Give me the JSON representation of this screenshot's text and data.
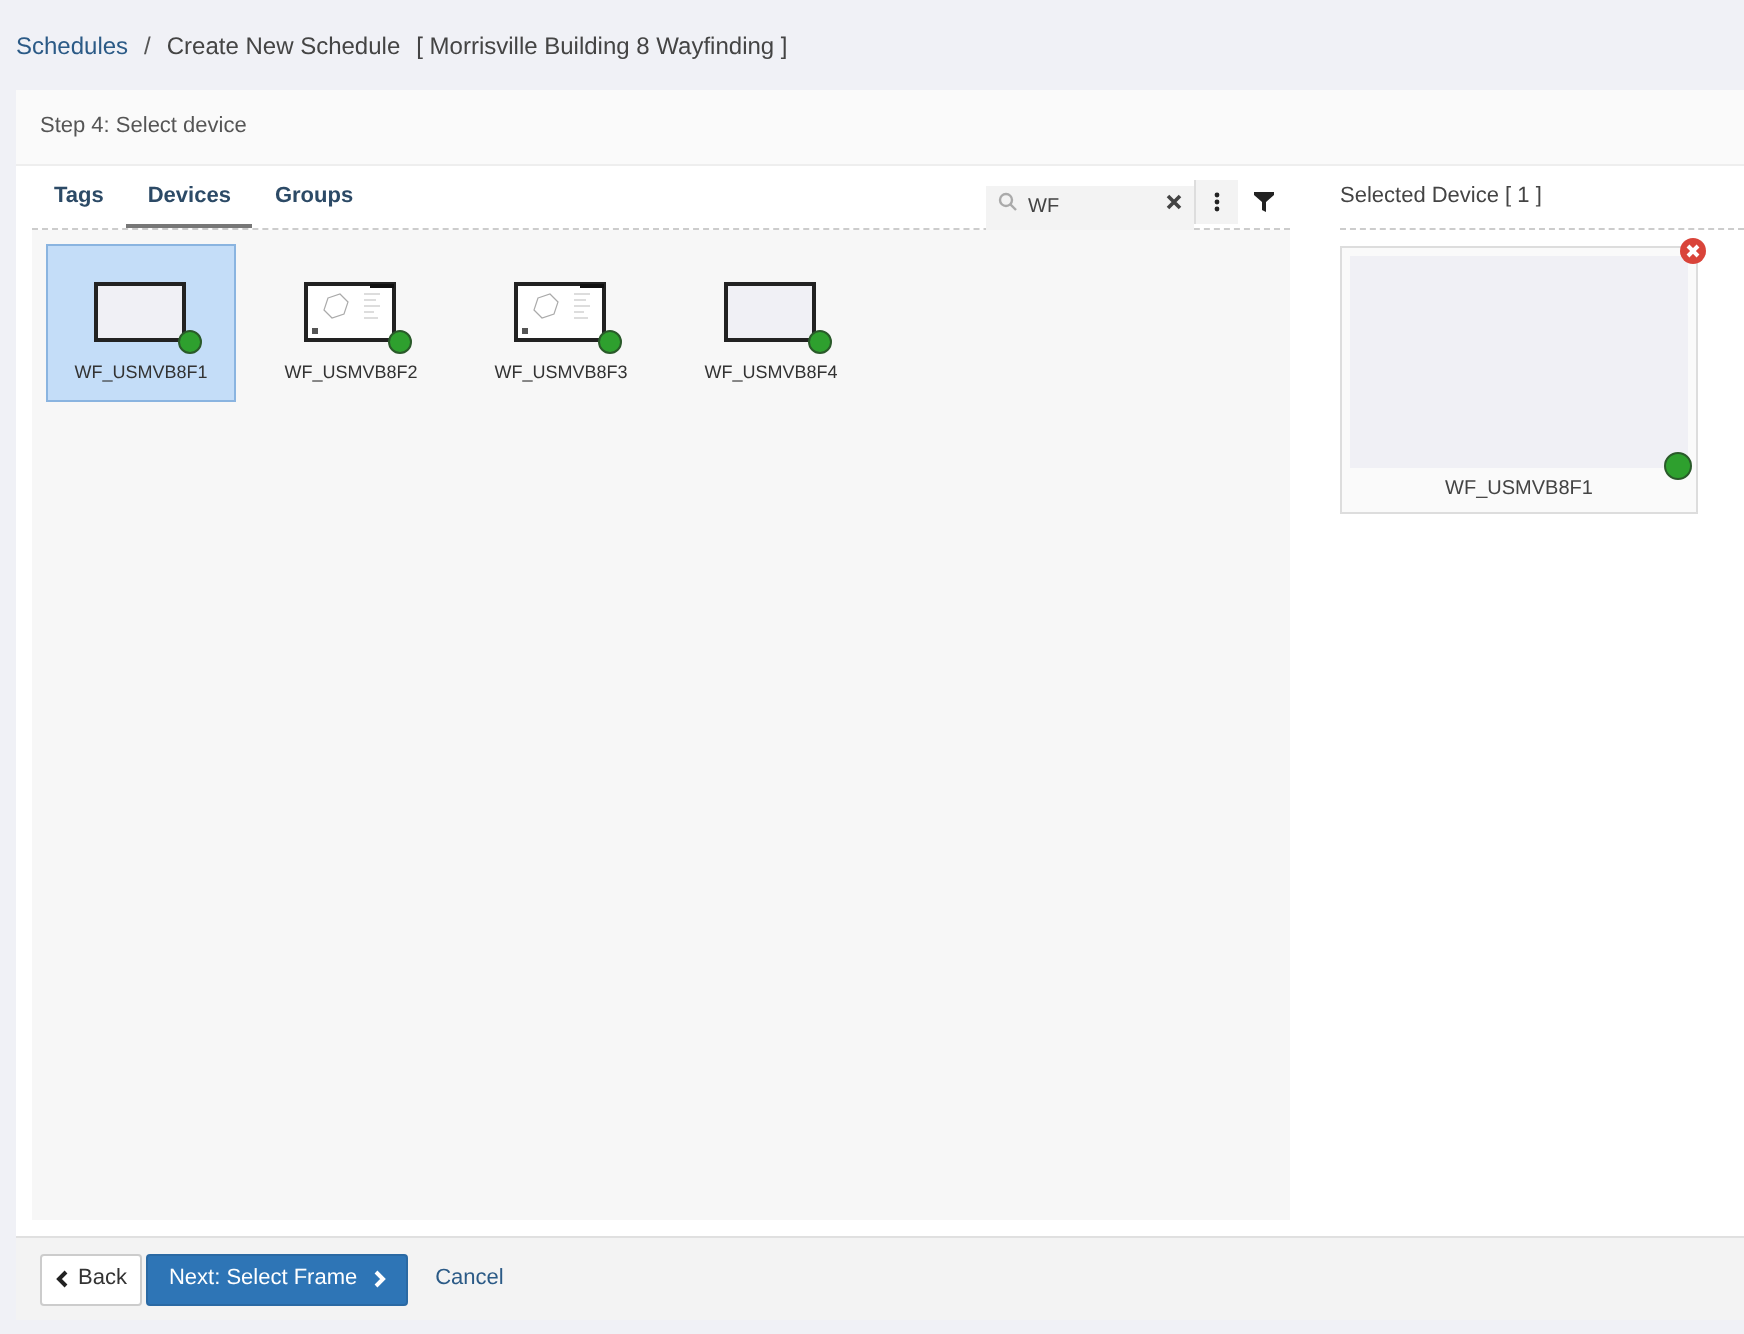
{
  "breadcrumb": {
    "root": "Schedules",
    "separator": "/",
    "current": "Create New Schedule",
    "context": "[ Morrisville Building 8 Wayfinding ]"
  },
  "step": "Step 4: Select device",
  "tabs": [
    {
      "label": "Tags",
      "selected": false
    },
    {
      "label": "Devices",
      "selected": true
    },
    {
      "label": "Groups",
      "selected": false
    }
  ],
  "search": {
    "value": "WF"
  },
  "devices": [
    {
      "name": "WF_USMVB8F1",
      "kind": "blank",
      "selected": true,
      "color": "#2ea02e"
    },
    {
      "name": "WF_USMVB8F2",
      "kind": "map",
      "selected": false,
      "color": "#2ea02e"
    },
    {
      "name": "WF_USMVB8F3",
      "kind": "map",
      "selected": false,
      "color": "#2ea02e"
    },
    {
      "name": "WF_USMVB8F4",
      "kind": "blank",
      "selected": false,
      "color": "#2ea02e"
    }
  ],
  "selected_panel": {
    "title": "Selected Device [ 1 ]",
    "devices": [
      {
        "name": "WF_USMVB8F1",
        "color": "#2ea02e"
      }
    ]
  },
  "footer": {
    "back": "Back",
    "next": "Next: Select Frame",
    "cancel": "Cancel"
  }
}
